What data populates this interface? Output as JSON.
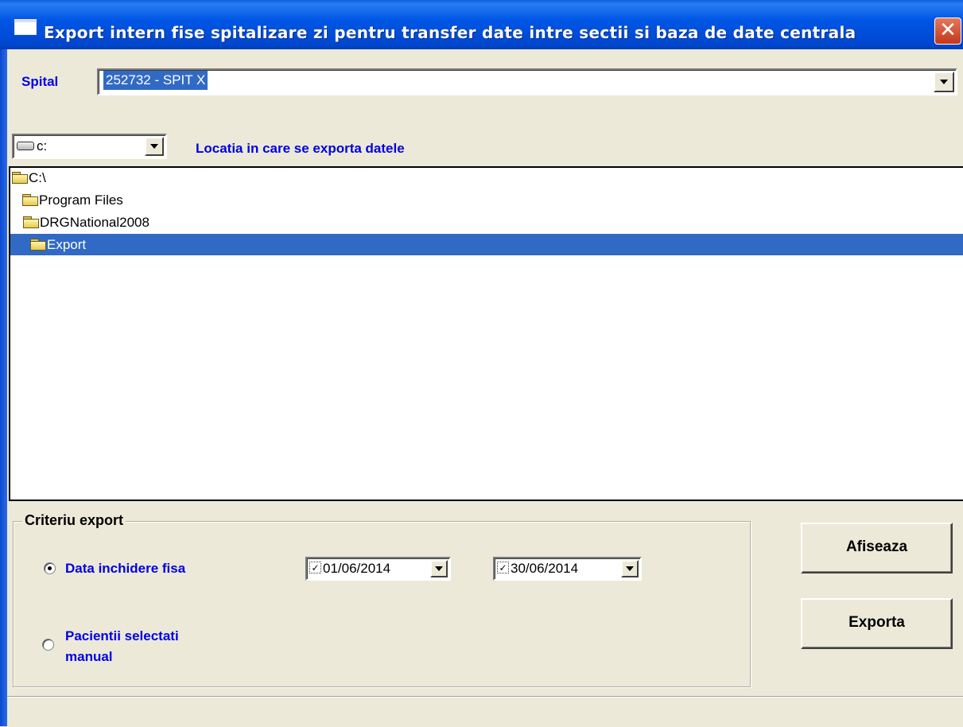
{
  "window": {
    "title": "Export intern fise spitalizare zi pentru transfer date intre sectii si baza de date centrala",
    "close_glyph": "✕"
  },
  "spital": {
    "label": "Spital",
    "value": "252732 - SPIT X"
  },
  "drive": {
    "value": "c:",
    "icon": "drive-icon"
  },
  "location_label": "Locatia in care se exporta datele",
  "directories": [
    {
      "name": "C:\\",
      "icon": "open-folder-icon"
    },
    {
      "name": "Program Files",
      "icon": "open-folder-icon"
    },
    {
      "name": "DRGNational2008",
      "icon": "open-folder-icon"
    },
    {
      "name": "Export",
      "icon": "open-folder-icon",
      "selected": true
    }
  ],
  "criteriu": {
    "title": "Criteriu export",
    "option_date": {
      "label": "Data inchidere fisa",
      "checked": true
    },
    "option_manual": {
      "label_line1": "Pacientii selectati",
      "label_line2": "manual",
      "checked": false
    },
    "date_from": {
      "value": "01/06/2014",
      "checked": true
    },
    "date_to": {
      "value": "30/06/2014",
      "checked": true
    },
    "check_glyph": "✓"
  },
  "buttons": {
    "afiseaza": "Afiseaza",
    "exporta": "Exporta"
  },
  "colors": {
    "titlebar": "#0054e3",
    "label_blue": "#0000e6",
    "selection": "#316ac5",
    "background": "#ece9d8"
  }
}
